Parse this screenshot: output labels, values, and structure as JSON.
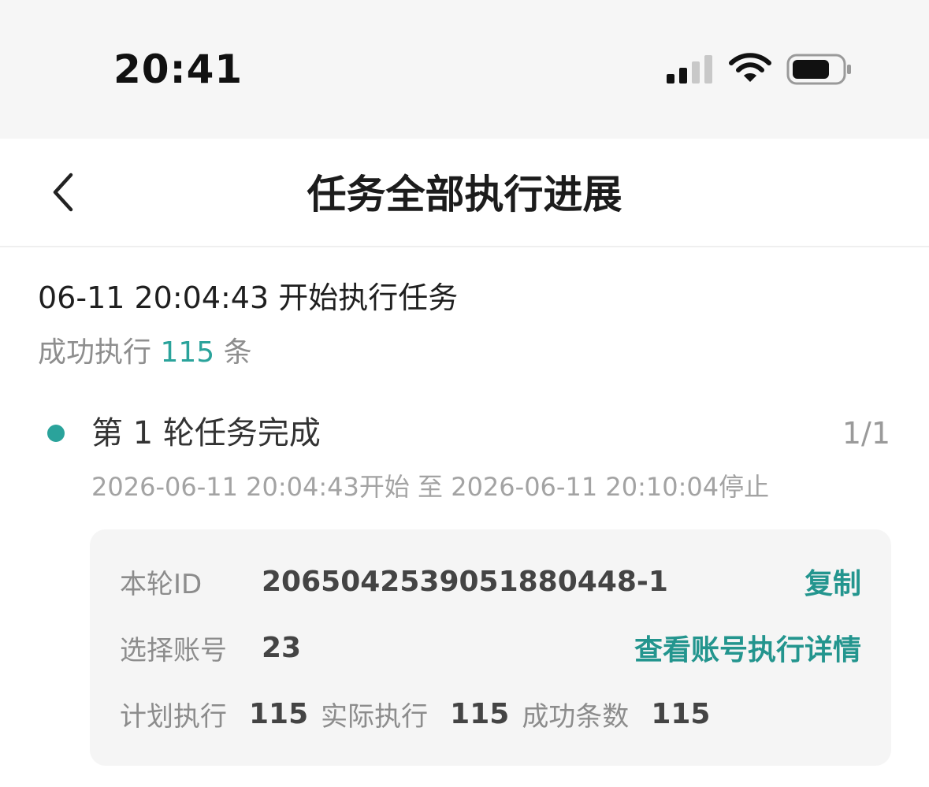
{
  "status_bar": {
    "time": "20:41"
  },
  "nav": {
    "title": "任务全部执行进展"
  },
  "task": {
    "start_text": "06-11 20:04:43 开始执行任务",
    "summary_prefix": "成功执行",
    "summary_count": "115",
    "summary_suffix": "条"
  },
  "round": {
    "title": "第 1 轮任务完成",
    "count": "1/1",
    "time_range": "2026-06-11 20:04:43开始 至 2026-06-11 20:10:04停止",
    "id_label": "本轮ID",
    "id_value": "2065042539051880448-1",
    "copy_label": "复制",
    "account_label": "选择账号",
    "account_value": "23",
    "account_detail_link": "查看账号执行详情",
    "planned_label": "计划执行",
    "planned_value": "115",
    "actual_label": "实际执行",
    "actual_value": "115",
    "success_label": "成功条数",
    "success_value": "115"
  },
  "colors": {
    "accent": "#2aa39b",
    "link": "#23958e"
  }
}
